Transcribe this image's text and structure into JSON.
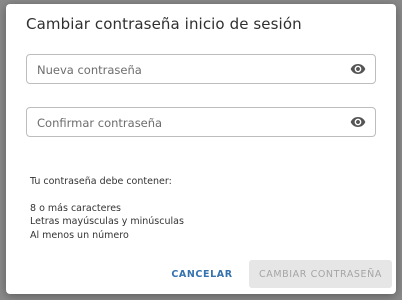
{
  "dialog": {
    "title": "Cambiar contraseña inicio de sesión"
  },
  "fields": {
    "new_password": {
      "placeholder": "Nueva contraseña",
      "value": "",
      "icon": "eye-icon"
    },
    "confirm_password": {
      "placeholder": "Confirmar contraseña",
      "value": "",
      "icon": "eye-icon"
    }
  },
  "requirements": {
    "intro": "Tu contraseña debe contener:",
    "items": [
      "8 o más caracteres",
      "Letras mayúsculas y minúsculas",
      "Al menos un número"
    ]
  },
  "actions": {
    "cancel_label": "CANCELAR",
    "submit_label": "CAMBIAR CONTRASEÑA"
  },
  "colors": {
    "accent": "#3572b0",
    "disabled_bg": "#e6e6e6",
    "disabled_text": "#a5a5a5"
  }
}
